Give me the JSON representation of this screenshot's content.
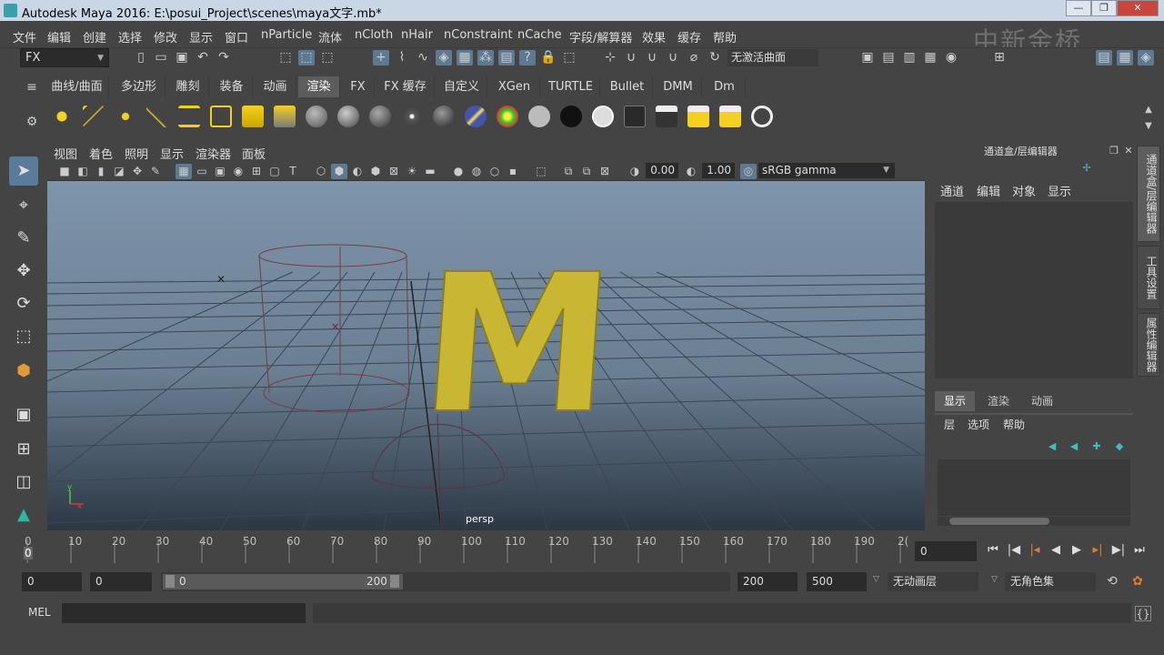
{
  "window": {
    "title": "Autodesk Maya 2016: E:\\posui_Project\\scenes\\maya文字.mb*",
    "minimize": "—",
    "restore": "❐",
    "close": "✕"
  },
  "watermark": "中新金桥",
  "menu": [
    "文件",
    "编辑",
    "创建",
    "选择",
    "修改",
    "显示",
    "窗口",
    "nParticle",
    "流体",
    "nCloth",
    "nHair",
    "nConstraint",
    "nCache",
    "字段/解算器",
    "效果",
    "缓存",
    "帮助"
  ],
  "status": {
    "mode": "FX",
    "live_surface": "无激活曲面"
  },
  "shelf_tabs": [
    "曲线/曲面",
    "多边形",
    "雕刻",
    "装备",
    "动画",
    "渲染",
    "FX",
    "FX 缓存",
    "自定义",
    "XGen",
    "TURTLE",
    "Bullet",
    "DMM",
    "Dm"
  ],
  "shelf_active": "渲染",
  "panel_menu": [
    "视图",
    "着色",
    "照明",
    "显示",
    "渲染器",
    "面板"
  ],
  "panel_toolbar": {
    "exposure": "0.00",
    "gamma": "1.00",
    "color_space": "sRGB gamma"
  },
  "viewport": {
    "camera_label": "persp",
    "object_letter": "M"
  },
  "channel_box": {
    "title": "通道盒/层编辑器",
    "menus": [
      "通道",
      "编辑",
      "对象",
      "显示"
    ],
    "layer_tabs": [
      "显示",
      "渲染",
      "动画"
    ],
    "layer_tab_active": "显示",
    "layer_menus": [
      "层",
      "选项",
      "帮助"
    ]
  },
  "side_tabs": [
    "通道盒/层编辑器",
    "工具设置",
    "属性编辑器"
  ],
  "timeline": {
    "ticks": [
      "0",
      "10",
      "20",
      "30",
      "40",
      "50",
      "60",
      "70",
      "80",
      "90",
      "100",
      "110",
      "120",
      "130",
      "140",
      "150",
      "160",
      "170",
      "180",
      "190",
      "2("
    ],
    "current_frame_marker": "0",
    "current_frame": "0"
  },
  "range": {
    "start": "0",
    "anim_start": "0",
    "slider_start": "0",
    "slider_end": "200",
    "end": "200",
    "anim_end": "500",
    "anim_layer": "无动画层",
    "character_set": "无角色集"
  },
  "command_line": {
    "label": "MEL"
  },
  "colors": {
    "accent": "#5b7b9a",
    "viewport_top": "#7e94aa",
    "viewport_bottom": "#2c3744",
    "text_mesh": "#d4c23a"
  }
}
